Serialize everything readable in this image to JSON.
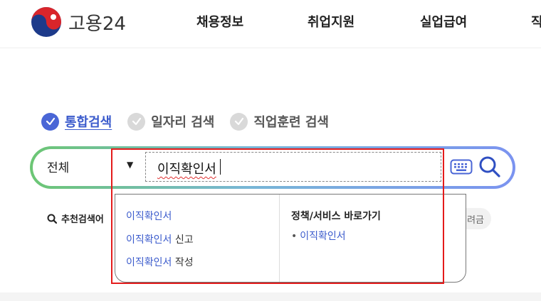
{
  "header": {
    "logo_text": "고용24",
    "nav": [
      "채용정보",
      "취업지원",
      "실업급여",
      "직"
    ]
  },
  "search_tabs": [
    {
      "label": "통합검색",
      "active": true
    },
    {
      "label": "일자리 검색",
      "active": false
    },
    {
      "label": "직업훈련 검색",
      "active": false
    }
  ],
  "search": {
    "scope": "전체",
    "query": "이직확인서",
    "keyboard_icon": "keyboard-icon",
    "search_icon": "search-icon"
  },
  "recommended": {
    "label": "추천검색어",
    "pill_text": "려금"
  },
  "dropdown": {
    "suggestions": [
      {
        "highlight": "이직확인서",
        "rest": ""
      },
      {
        "highlight": "이직확인서",
        "rest": " 신고"
      },
      {
        "highlight": "이직확인서",
        "rest": " 작성"
      }
    ],
    "policy_title": "정책/서비스 바로가기",
    "policy_items": [
      "이직확인서"
    ]
  },
  "colors": {
    "accent": "#3b5bcc",
    "highlight_box": "#e41b1b",
    "gradient_left": "#6cc674",
    "gradient_right": "#7b93f0"
  }
}
